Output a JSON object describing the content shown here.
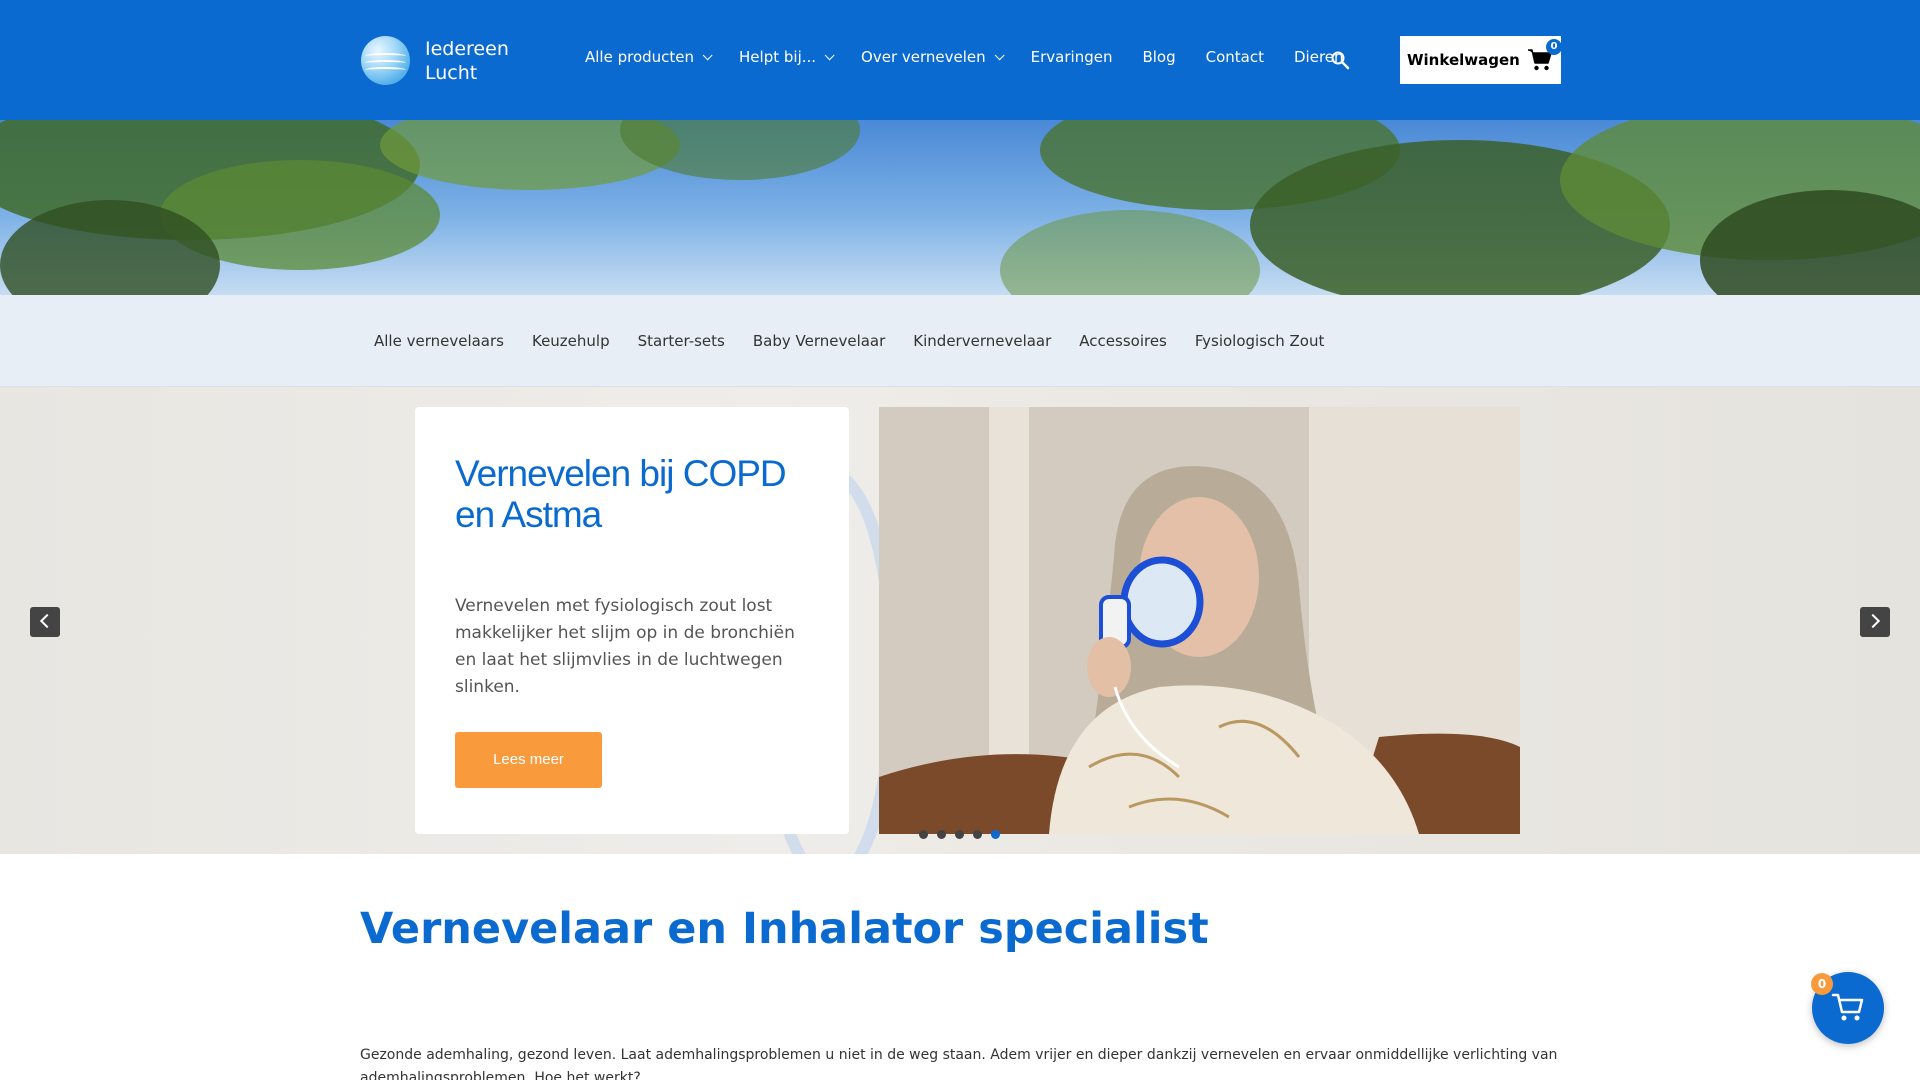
{
  "header": {
    "brand_line1": "Iedereen",
    "brand_line2": "Lucht",
    "nav": [
      {
        "label": "Alle producten",
        "dropdown": true
      },
      {
        "label": "Helpt bij...",
        "dropdown": true
      },
      {
        "label": "Over vernevelen",
        "dropdown": true
      },
      {
        "label": "Ervaringen",
        "dropdown": false
      },
      {
        "label": "Blog",
        "dropdown": false
      },
      {
        "label": "Contact",
        "dropdown": false
      },
      {
        "label": "Dieren",
        "dropdown": false
      }
    ],
    "search_icon": "search-icon",
    "cart_label": "Winkelwagen",
    "cart_count": "0",
    "color": "#0a6acf"
  },
  "categories": [
    "Alle vernevelaars",
    "Keuzehulp",
    "Starter-sets",
    "Baby Vernevelaar",
    "Kindervernevelaar",
    "Accessoires",
    "Fysiologisch Zout"
  ],
  "slider": {
    "title": "Vernevelen bij COPD en Astma",
    "text": "Vernevelen met fysiologisch zout lost makkelijker het slijm op in de bronchiën en laat het slijmvlies in de luchtwegen slinken.",
    "button": "Lees meer",
    "slide_count": 5,
    "active_slide": 5,
    "button_color": "#f99b3d"
  },
  "content": {
    "heading": "Vernevelaar en Inhalator specialist",
    "intro": "Gezonde ademhaling, gezond leven. Laat ademhalingsproblemen u niet in de weg staan. Adem vrijer en dieper dankzij vernevelen en ervaar onmiddellijke verlichting van ademhalingsproblemen. Hoe het werkt?"
  },
  "floating_cart": {
    "count": "0"
  }
}
